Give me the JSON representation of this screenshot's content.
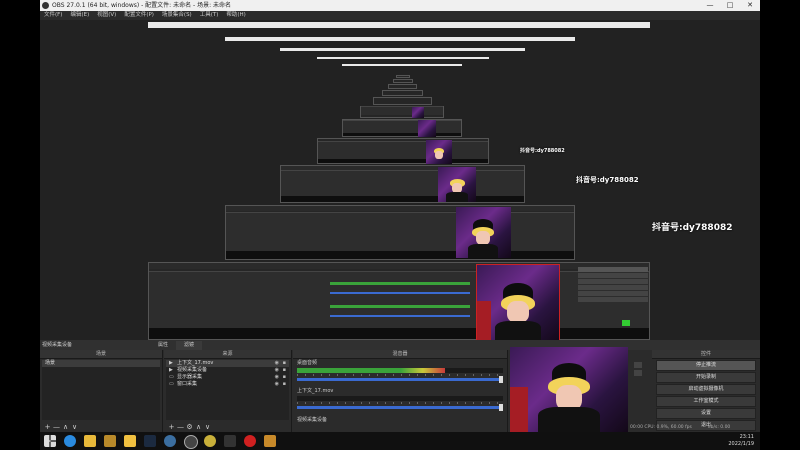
{
  "window": {
    "title": "OBS 27.0.1 (64 bit, windows) - 配置文件: 未命名 - 场景: 未命名",
    "controls": [
      "—",
      "□",
      "✕"
    ]
  },
  "menu": [
    "文件(F)",
    "编辑(E)",
    "视图(V)",
    "配置文件(P)",
    "场景集合(S)",
    "工具(T)",
    "帮助(H)"
  ],
  "overlay": {
    "line1": "抖音号:dy788082",
    "line2": "抖音号:dy788082",
    "line3": "抖音号:dy788082"
  },
  "scenes_panel": {
    "header": "场景",
    "items": [
      "场景"
    ],
    "footer": [
      "+",
      "—",
      "∧",
      "∨"
    ]
  },
  "sources_panel": {
    "header": "来源",
    "items": [
      {
        "icon": "▶",
        "label": "上下文_17.mov"
      },
      {
        "icon": "▶",
        "label": "视频采集设备"
      },
      {
        "icon": "▭",
        "label": "显示器采集"
      },
      {
        "icon": "▭",
        "label": "窗口采集"
      }
    ],
    "footer": [
      "+",
      "—",
      "⚙",
      "∧",
      "∨"
    ]
  },
  "dock_top": {
    "label": "视频采集设备",
    "tabs": [
      "属性",
      "滤镜"
    ]
  },
  "mixer_panel": {
    "header": "混音器",
    "channels": [
      {
        "name": "桌面音频",
        "level": 0.72
      },
      {
        "name": "上下文_17.mov",
        "level": 0.0
      }
    ],
    "footer": "视频采集设备"
  },
  "controls_panel": {
    "header": "控件",
    "buttons": [
      "停止推流",
      "开始录制",
      "启动虚拟摄像机",
      "工作室模式",
      "设置",
      "退出"
    ]
  },
  "status": {
    "text": "00:00  CPU: 0.9%, 60.00 fps",
    "kbps": "kb/s: 0.00"
  },
  "tray": {
    "time": "23:11",
    "date": "2022/1/19"
  }
}
